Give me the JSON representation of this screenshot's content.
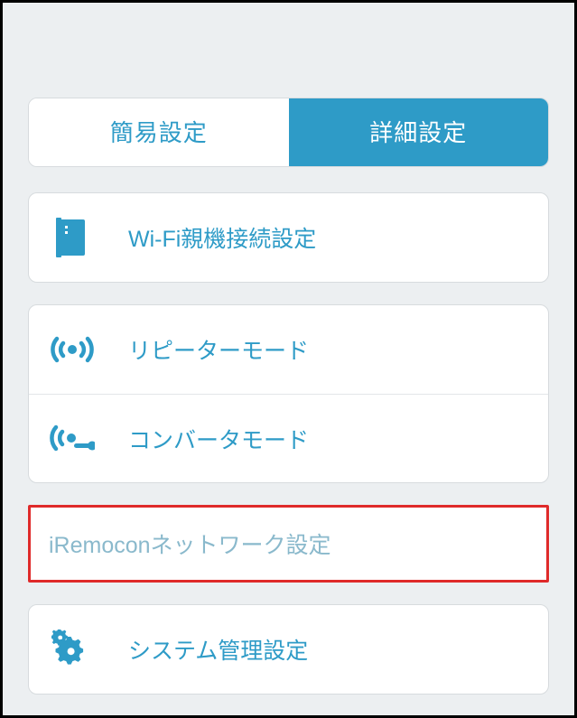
{
  "colors": {
    "accent": "#2e9bc7",
    "highlight_border": "#df2a2a",
    "background": "#eceff1",
    "muted_text": "#8ab9cc"
  },
  "tabs": {
    "simple": "簡易設定",
    "advanced": "詳細設定",
    "active": "advanced"
  },
  "menu": {
    "wifi_parent": "Wi-Fi親機接続設定",
    "repeater": "リピーターモード",
    "converter": "コンバータモード",
    "iremocon": "iRemoconネットワーク設定",
    "system": "システム管理設定"
  }
}
